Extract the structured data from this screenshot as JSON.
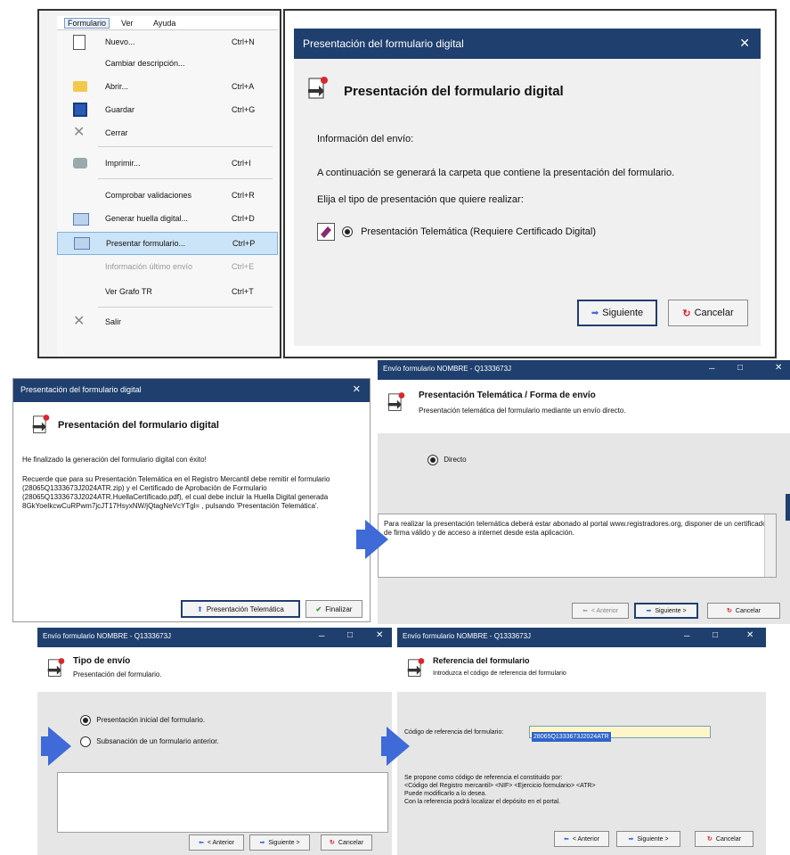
{
  "menu": {
    "bar": [
      "Formulario",
      "Ver",
      "Ayuda"
    ],
    "items": [
      {
        "label": "Nuevo...",
        "shortcut": "Ctrl+N"
      },
      {
        "label": "Cambiar descripción...",
        "shortcut": ""
      },
      {
        "label": "Abrir...",
        "shortcut": "Ctrl+A"
      },
      {
        "label": "Guardar",
        "shortcut": "Ctrl+G"
      },
      {
        "label": "Cerrar",
        "shortcut": ""
      },
      {
        "label": "Imprimir...",
        "shortcut": "Ctrl+I"
      },
      {
        "label": "Comprobar validaciones",
        "shortcut": "Ctrl+R"
      },
      {
        "label": "Generar huella digital...",
        "shortcut": "Ctrl+D"
      },
      {
        "label": "Presentar formulario...",
        "shortcut": "Ctrl+P"
      },
      {
        "label": "Información último envío",
        "shortcut": "Ctrl+E"
      },
      {
        "label": "Ver Grafo TR",
        "shortcut": "Ctrl+T"
      },
      {
        "label": "Salir",
        "shortcut": ""
      }
    ],
    "highlight_color": "#cce4f7"
  },
  "dialog1": {
    "title": "Presentación del formulario digital",
    "heading": "Presentación del formulario digital",
    "info": "Información del envío:",
    "line1": "A continuación se generará la carpeta que contiene la presentación del formulario.",
    "line2": "Elija el tipo de presentación que quiere realizar:",
    "option": "Presentación Telemática (Requiere Certificado Digital)",
    "next": "Siguiente",
    "cancel": "Cancelar"
  },
  "dialog2": {
    "title": "Presentación del formulario digital",
    "heading": "Presentación del formulario digital",
    "p1": "He finalizado la generación del formulario digital con éxito!",
    "p2": "Recuerde que para su Presentación Telemática en el Registro Mercantil debe remitir el formulario (28065Q1333673J2024ATR.zip) y el Certificado de Aprobación de Formulario (28065Q1333673J2024ATR.HuellaCertificado.pdf), el cual debe incluir la Huella Digital generada 8GkYoeIkcwCuRPwm7jcJT17HsyxNW/jQtagNeVcYTgl= , pulsando 'Presentación Telemática'.",
    "btn_tele": "Presentación Telemática",
    "btn_fin": "Finalizar"
  },
  "wizard1": {
    "title": "Envío formulario NOMBRE - Q1333673J",
    "heading": "Presentación Telemática / Forma de envío",
    "sub": "Presentación telemática del formulario mediante un envío directo.",
    "option": "Directo",
    "note": "Para realizar la presentación telemática deberá estar abonado al portal www.registradores.org, disponer de un certificado de firma válido y de acceso a internet desde esta aplicación.",
    "prev": "< Anterior",
    "next": "Siguiente >",
    "cancel": "Cancelar"
  },
  "wizard2": {
    "title": "Envío formulario NOMBRE - Q1333673J",
    "heading": "Tipo de envío",
    "sub": "Presentación del formulario.",
    "opt1": "Presentación inicial del formulario.",
    "opt2": "Subsanación de un formulario anterior.",
    "prev": "< Anterior",
    "next": "Siguiente >",
    "cancel": "Cancelar"
  },
  "wizard3": {
    "title": "Envío formulario NOMBRE - Q1333673J",
    "heading": "Referencia del formulario",
    "sub": "Introduzca el código de referencia del formulario",
    "field_label": "Código de referencia del formulario:",
    "field_value": "28065Q1333673J2024ATR",
    "note": "Se propone como código de referencia el constituido por:\n<Código del Registro mercantil> <NIF> <Ejercicio formulario> <ATR>\nPuede modificarlo a lo desea.\nCon la referencia podrá localizar el depósito en el portal.",
    "prev": "< Anterior",
    "next": "Siguiente >",
    "cancel": "Cancelar"
  },
  "window_controls": {
    "minimize": "─",
    "maximize": "□",
    "close": "✕"
  },
  "colors": {
    "titlebar": "#1f3f6e",
    "arrow": "#3f6ad8",
    "panel": "#e6e6e6",
    "cancel_icon": "#d9272e",
    "field_bg": "#fff6c7"
  }
}
